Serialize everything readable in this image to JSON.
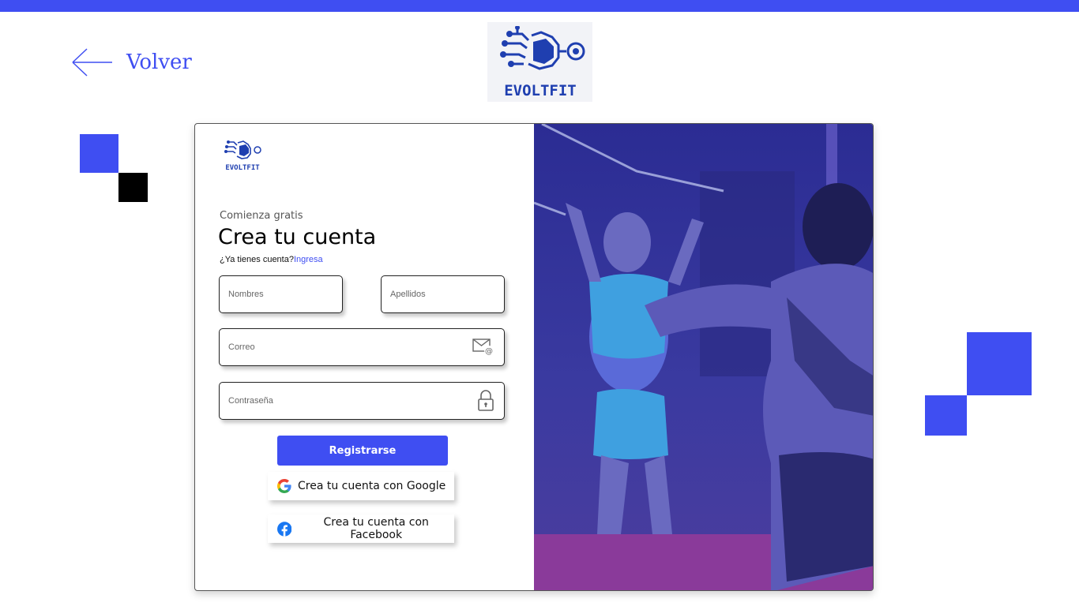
{
  "header": {
    "back_label": "Volver",
    "brand": "EVOLTFIT"
  },
  "form": {
    "subtitle": "Comienza gratis",
    "title": "Crea tu cuenta",
    "have_account_text": "¿Ya tienes cuenta?",
    "login_link": "Ingresa",
    "fields": {
      "first_name": {
        "placeholder": "Nombres",
        "value": ""
      },
      "last_name": {
        "placeholder": "Apellidos",
        "value": ""
      },
      "email": {
        "placeholder": "Correo",
        "value": ""
      },
      "password": {
        "placeholder": "Contraseña",
        "value": ""
      }
    },
    "submit_label": "Registrarse",
    "google_label": "Crea tu cuenta con Google",
    "facebook_label": "Crea tu cuenta con Facebook"
  },
  "icons": {
    "back": "arrow-left-icon",
    "email": "envelope-at-icon",
    "password": "padlock-icon",
    "google": "google-icon",
    "facebook": "facebook-icon"
  },
  "colors": {
    "accent": "#3f4ef2",
    "photo_overlay": "#3f3ca8",
    "black": "#000000"
  }
}
